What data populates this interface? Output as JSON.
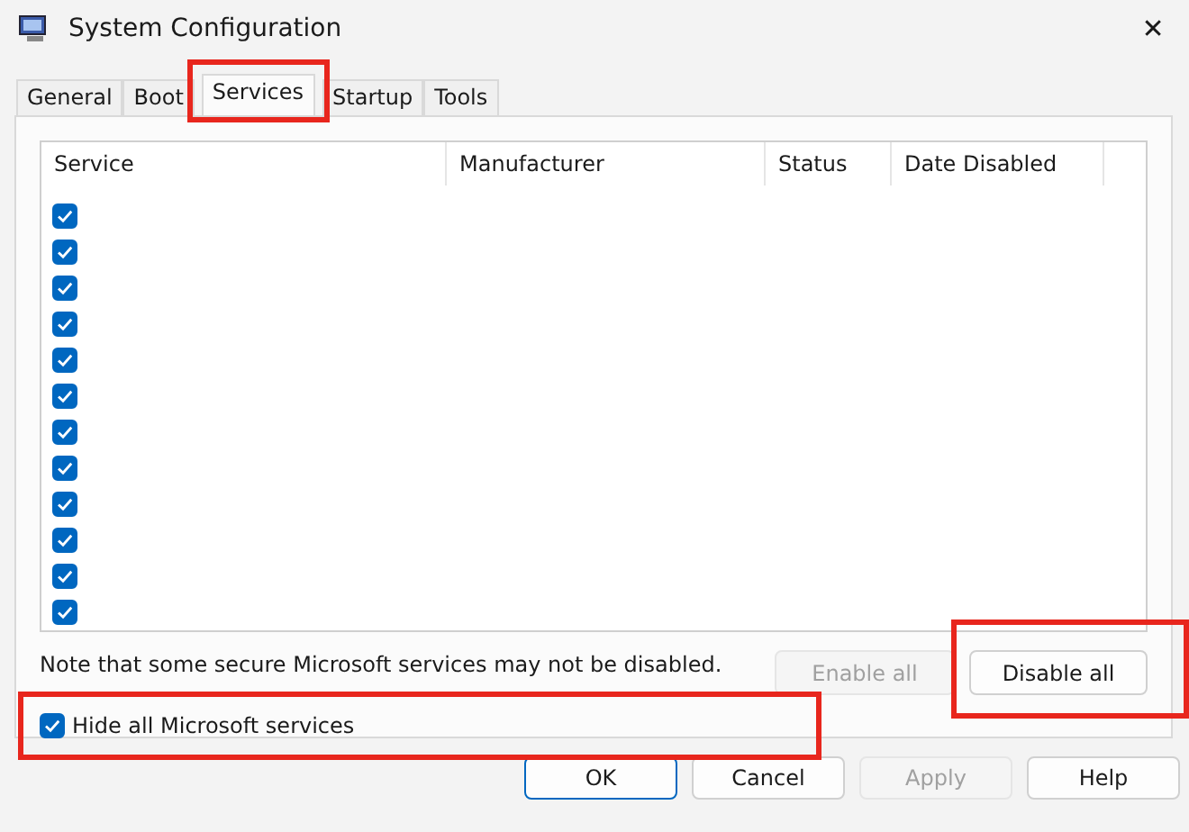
{
  "window": {
    "title": "System Configuration",
    "close": "✕"
  },
  "tabs": [
    {
      "label": "General",
      "selected": false,
      "highlighted": false
    },
    {
      "label": "Boot",
      "selected": false,
      "highlighted": false
    },
    {
      "label": "Services",
      "selected": true,
      "highlighted": true
    },
    {
      "label": "Startup",
      "selected": false,
      "highlighted": false
    },
    {
      "label": "Tools",
      "selected": false,
      "highlighted": false
    }
  ],
  "table": {
    "columns": [
      "Service",
      "Manufacturer",
      "Status",
      "Date Disabled"
    ],
    "rows": [
      {
        "checked": true
      },
      {
        "checked": true
      },
      {
        "checked": true
      },
      {
        "checked": true
      },
      {
        "checked": true
      },
      {
        "checked": true
      },
      {
        "checked": true
      },
      {
        "checked": true
      },
      {
        "checked": true
      },
      {
        "checked": true
      },
      {
        "checked": true
      },
      {
        "checked": true
      }
    ]
  },
  "note": "Note that some secure Microsoft services may not be disabled.",
  "panel_buttons": [
    {
      "label": "Enable all",
      "disabled": true,
      "highlighted": false
    },
    {
      "label": "Disable all",
      "disabled": false,
      "highlighted": true
    }
  ],
  "hide_microsoft": {
    "label": "Hide all Microsoft services",
    "checked": true,
    "highlighted": true
  },
  "buttons": [
    {
      "label": "OK",
      "default": true,
      "disabled": false
    },
    {
      "label": "Cancel",
      "default": false,
      "disabled": false
    },
    {
      "label": "Apply",
      "default": false,
      "disabled": true
    },
    {
      "label": "Help",
      "default": false,
      "disabled": false
    }
  ]
}
